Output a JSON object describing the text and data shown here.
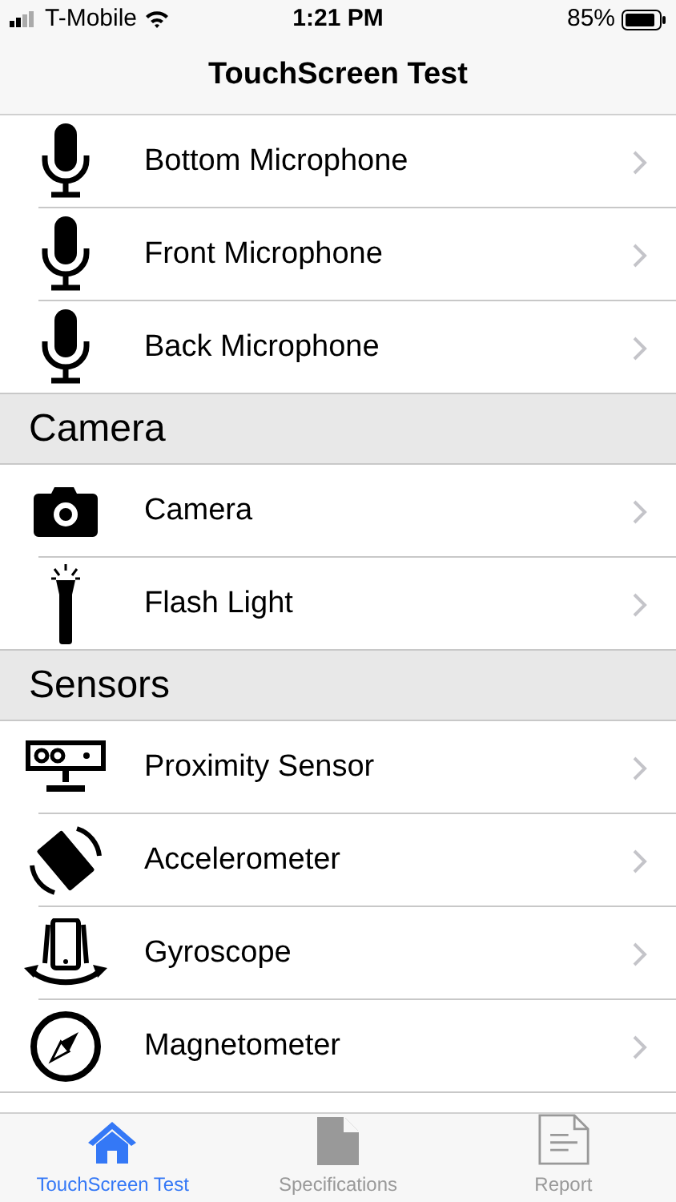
{
  "status_bar": {
    "carrier": "T-Mobile",
    "time": "1:21 PM",
    "battery": "85%"
  },
  "nav": {
    "title": "TouchScreen Test"
  },
  "sections": [
    {
      "items": [
        {
          "kind": "microphone",
          "label": "Bottom Microphone"
        },
        {
          "kind": "microphone",
          "label": "Front Microphone"
        },
        {
          "kind": "microphone",
          "label": "Back Microphone"
        }
      ]
    },
    {
      "header": "Camera",
      "items": [
        {
          "kind": "camera",
          "label": "Camera"
        },
        {
          "kind": "flashlight",
          "label": "Flash Light"
        }
      ]
    },
    {
      "header": "Sensors",
      "items": [
        {
          "kind": "proximity",
          "label": "Proximity Sensor"
        },
        {
          "kind": "rotation",
          "label": "Accelerometer"
        },
        {
          "kind": "gyroscope",
          "label": "Gyroscope"
        },
        {
          "kind": "compass",
          "label": "Magnetometer"
        }
      ]
    }
  ],
  "tabs": [
    {
      "kind": "home",
      "label": "TouchScreen Test",
      "selected": true
    },
    {
      "kind": "document",
      "label": "Specifications",
      "selected": false
    },
    {
      "kind": "report",
      "label": "Report",
      "selected": false
    }
  ]
}
